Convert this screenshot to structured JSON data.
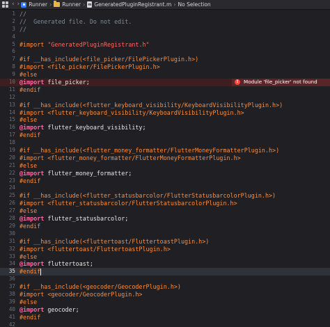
{
  "jump_bar": {
    "items": [
      {
        "label": "Runner",
        "icon": "xcode-app-icon"
      },
      {
        "label": "Runner",
        "icon": "folder-icon"
      },
      {
        "label": "GeneratedPluginRegistrant.m",
        "icon": "objc-file-icon",
        "file_badge": "m"
      },
      {
        "label": "No Selection",
        "icon": ""
      }
    ]
  },
  "editor": {
    "current_line": 35,
    "error": {
      "line": 10,
      "message": "Module 'file_picker' not found",
      "icon_glyph": "!"
    },
    "lines": [
      {
        "n": "1",
        "t": [
          {
            "c": "cm",
            "s": "//"
          }
        ]
      },
      {
        "n": "2",
        "t": [
          {
            "c": "cm",
            "s": "//  Generated file. Do not edit."
          }
        ]
      },
      {
        "n": "3",
        "t": [
          {
            "c": "cm",
            "s": "//"
          }
        ]
      },
      {
        "n": "4",
        "t": []
      },
      {
        "n": "5",
        "t": [
          {
            "c": "pp",
            "s": "#import "
          },
          {
            "c": "str",
            "s": "\"GeneratedPluginRegistrant.h\""
          }
        ]
      },
      {
        "n": "6",
        "t": []
      },
      {
        "n": "7",
        "t": [
          {
            "c": "pp",
            "s": "#if __has_include(<file_picker/FilePickerPlugin.h>)"
          }
        ]
      },
      {
        "n": "8",
        "t": [
          {
            "c": "pp",
            "s": "#import <file_picker/FilePickerPlugin.h>"
          }
        ]
      },
      {
        "n": "9",
        "t": [
          {
            "c": "pp",
            "s": "#else"
          }
        ]
      },
      {
        "n": "10",
        "t": [
          {
            "c": "kw",
            "s": "@import"
          },
          {
            "c": "plain",
            "s": " file_picker;"
          }
        ]
      },
      {
        "n": "11",
        "t": [
          {
            "c": "pp",
            "s": "#endif"
          }
        ]
      },
      {
        "n": "12",
        "t": []
      },
      {
        "n": "13",
        "t": [
          {
            "c": "pp",
            "s": "#if __has_include(<flutter_keyboard_visibility/KeyboardVisibilityPlugin.h>)"
          }
        ]
      },
      {
        "n": "14",
        "t": [
          {
            "c": "pp",
            "s": "#import <flutter_keyboard_visibility/KeyboardVisibilityPlugin.h>"
          }
        ]
      },
      {
        "n": "15",
        "t": [
          {
            "c": "pp",
            "s": "#else"
          }
        ]
      },
      {
        "n": "16",
        "t": [
          {
            "c": "kw",
            "s": "@import"
          },
          {
            "c": "plain",
            "s": " flutter_keyboard_visibility;"
          }
        ]
      },
      {
        "n": "17",
        "t": [
          {
            "c": "pp",
            "s": "#endif"
          }
        ]
      },
      {
        "n": "18",
        "t": []
      },
      {
        "n": "19",
        "t": [
          {
            "c": "pp",
            "s": "#if __has_include(<flutter_money_formatter/FlutterMoneyFormatterPlugin.h>)"
          }
        ]
      },
      {
        "n": "20",
        "t": [
          {
            "c": "pp",
            "s": "#import <flutter_money_formatter/FlutterMoneyFormatterPlugin.h>"
          }
        ]
      },
      {
        "n": "21",
        "t": [
          {
            "c": "pp",
            "s": "#else"
          }
        ]
      },
      {
        "n": "22",
        "t": [
          {
            "c": "kw",
            "s": "@import"
          },
          {
            "c": "plain",
            "s": " flutter_money_formatter;"
          }
        ]
      },
      {
        "n": "23",
        "t": [
          {
            "c": "pp",
            "s": "#endif"
          }
        ]
      },
      {
        "n": "24",
        "t": []
      },
      {
        "n": "25",
        "t": [
          {
            "c": "pp",
            "s": "#if __has_include(<flutter_statusbarcolor/FlutterStatusbarcolorPlugin.h>)"
          }
        ]
      },
      {
        "n": "26",
        "t": [
          {
            "c": "pp",
            "s": "#import <flutter_statusbarcolor/FlutterStatusbarcolorPlugin.h>"
          }
        ]
      },
      {
        "n": "27",
        "t": [
          {
            "c": "pp",
            "s": "#else"
          }
        ]
      },
      {
        "n": "28",
        "t": [
          {
            "c": "kw",
            "s": "@import"
          },
          {
            "c": "plain",
            "s": " flutter_statusbarcolor;"
          }
        ]
      },
      {
        "n": "29",
        "t": [
          {
            "c": "pp",
            "s": "#endif"
          }
        ]
      },
      {
        "n": "30",
        "t": []
      },
      {
        "n": "31",
        "t": [
          {
            "c": "pp",
            "s": "#if __has_include(<fluttertoast/FluttertoastPlugin.h>)"
          }
        ]
      },
      {
        "n": "32",
        "t": [
          {
            "c": "pp",
            "s": "#import <fluttertoast/FluttertoastPlugin.h>"
          }
        ]
      },
      {
        "n": "33",
        "t": [
          {
            "c": "pp",
            "s": "#else"
          }
        ]
      },
      {
        "n": "34",
        "t": [
          {
            "c": "kw",
            "s": "@import"
          },
          {
            "c": "plain",
            "s": " fluttertoast;"
          }
        ]
      },
      {
        "n": "35",
        "t": [
          {
            "c": "pp",
            "s": "#endif"
          }
        ],
        "cursor": true
      },
      {
        "n": "36",
        "t": []
      },
      {
        "n": "37",
        "t": [
          {
            "c": "pp",
            "s": "#if __has_include(<geocoder/GeocoderPlugin.h>)"
          }
        ]
      },
      {
        "n": "38",
        "t": [
          {
            "c": "pp",
            "s": "#import <geocoder/GeocoderPlugin.h>"
          }
        ]
      },
      {
        "n": "39",
        "t": [
          {
            "c": "pp",
            "s": "#else"
          }
        ]
      },
      {
        "n": "40",
        "t": [
          {
            "c": "kw",
            "s": "@import"
          },
          {
            "c": "plain",
            "s": " geocoder;"
          }
        ]
      },
      {
        "n": "41",
        "t": [
          {
            "c": "pp",
            "s": "#endif"
          }
        ]
      },
      {
        "n": "42",
        "t": []
      }
    ]
  },
  "colors": {
    "background": "#1f1f24",
    "current_line": "#2f3239",
    "error_line": "#3f1e1f",
    "error_banner": "#5a2528",
    "keyword": "#fc6aa4",
    "preprocessor": "#fc8f3f",
    "comment": "#7f8c98",
    "string": "#fc6a5d"
  }
}
